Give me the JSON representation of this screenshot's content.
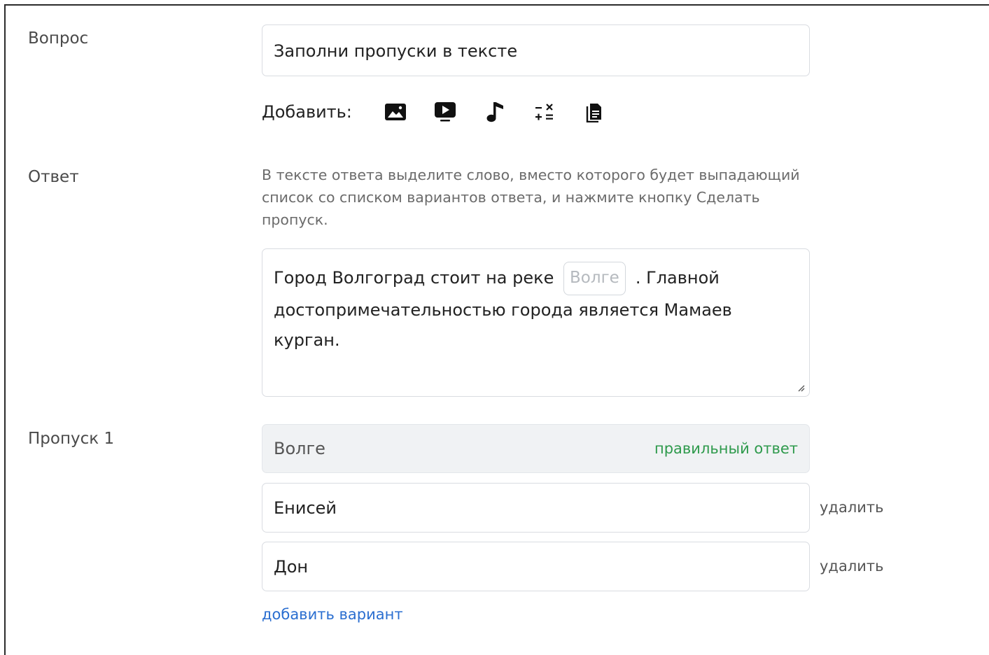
{
  "question": {
    "label": "Вопрос",
    "value": "Заполни пропуски в тексте"
  },
  "add": {
    "label": "Добавить:",
    "icons": [
      "image-icon",
      "video-icon",
      "music-icon",
      "formula-icon",
      "document-icon"
    ]
  },
  "answer": {
    "label": "Ответ",
    "hint": "В тексте ответа выделите слово, вместо которого будет выпадающий список со списком вариантов ответа, и нажмите кнопку Сделать пропуск.",
    "text_before": "Город Волгоград стоит на реке",
    "gap": "Волге",
    "text_after": ". Главной достопримечательностью города является Мамаев курган."
  },
  "gap1": {
    "label": "Пропуск 1",
    "correct_value": "Волге",
    "correct_tag": "правильный ответ",
    "options": [
      {
        "value": "Енисей",
        "delete_label": "удалить"
      },
      {
        "value": "Дон",
        "delete_label": "удалить"
      }
    ],
    "add_variant_label": "добавить вариант"
  },
  "colors": {
    "correct_tag": "#2e9a4c",
    "link": "#2a6ed0",
    "border": "#d9dce1"
  }
}
